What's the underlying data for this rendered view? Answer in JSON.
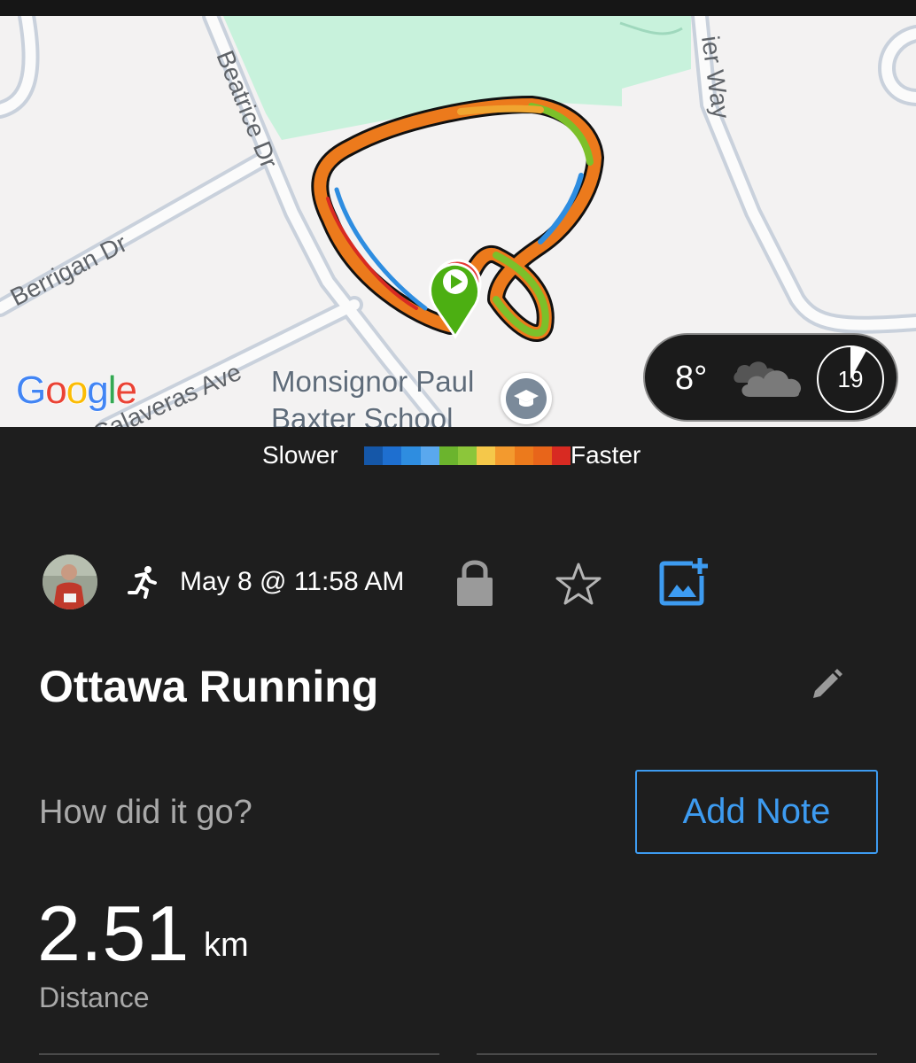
{
  "map": {
    "streets": {
      "beatrice": "Beatrice Dr",
      "berrigan": "Berrigan Dr",
      "calaveras": "Calaveras Ave",
      "way": "ier Way"
    },
    "provider_logo": [
      "G",
      "o",
      "o",
      "g",
      "l",
      "e"
    ],
    "provider_colors": [
      "#4285F4",
      "#EA4335",
      "#FBBC05",
      "#4285F4",
      "#34A853",
      "#EA4335"
    ],
    "poi_name_line1": "Monsignor Paul",
    "poi_name_line2": "Baxter School",
    "poi_icon": "school-icon",
    "route_colors": [
      "#ec7a1c",
      "#f0a530",
      "#7cc02a",
      "#2e8de0",
      "#d82a22"
    ],
    "start_marker_color": "#4caf12",
    "end_marker_color": "#e53935"
  },
  "weather": {
    "temperature": "8°",
    "condition_icon": "cloud-icon",
    "wind": "19"
  },
  "pace_legend": {
    "slower_label": "Slower",
    "faster_label": "Faster",
    "colors": [
      "#1557a8",
      "#1e6fd0",
      "#2e8de0",
      "#5aa8ee",
      "#6bb42d",
      "#8cc63a",
      "#f5c84a",
      "#f39a2e",
      "#ec7a1c",
      "#e8651a",
      "#d82a22"
    ]
  },
  "activity": {
    "activity_icon": "running-icon",
    "date": "May 8 @ 11:58 AM",
    "privacy_icon": "lock-icon",
    "favorite_icon": "star-icon",
    "add_photo_icon": "add-photo-icon",
    "title": "Ottawa Running",
    "edit_icon": "pencil-icon",
    "note_prompt": "How did it go?",
    "add_note_label": "Add Note"
  },
  "stats": {
    "distance_value": "2.51",
    "distance_unit": "km",
    "distance_label": "Distance"
  },
  "colors": {
    "background": "#1e1e1e",
    "accent": "#3d9bf0",
    "park": "#c8f2dc"
  }
}
